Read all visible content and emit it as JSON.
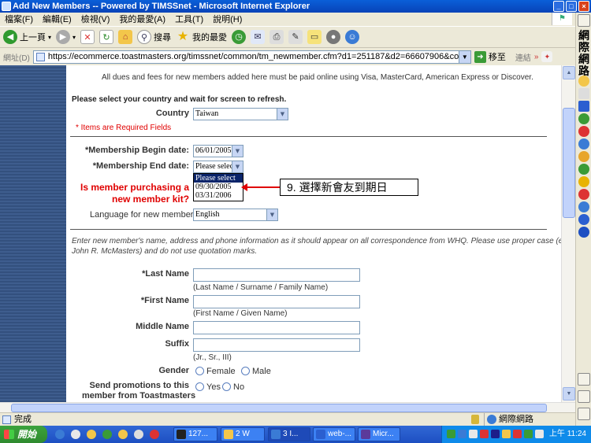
{
  "window": {
    "title": "Add New Members -- Powered by TIMSSnet - Microsoft Internet Explorer"
  },
  "menu": [
    "檔案(F)",
    "編輯(E)",
    "檢視(V)",
    "我的最愛(A)",
    "工具(T)",
    "說明(H)"
  ],
  "toolbar": {
    "back": "上一頁",
    "search": "搜尋",
    "favorites": "我的最愛"
  },
  "address": {
    "label": "網址(D)",
    "url": "https://ecommerce.toastmasters.org/timssnet/common/tm_newmember.cfm?d1=251187&d2=66607906&country=TW",
    "go": "移至",
    "links": "連結"
  },
  "sidebar": {
    "links_title": "網際網路"
  },
  "form": {
    "dues_notice": "All dues and fees for new members added here must be paid online using Visa, MasterCard, American Express or Discover.",
    "country_prompt": "Please select your country and wait for screen to refresh.",
    "country_label": "Country",
    "country_value": "Taiwan",
    "required_note": "* Items are Required Fields",
    "begin_label": "*Membership Begin date:",
    "begin_value": "06/01/2005",
    "end_label": "*Membership End date:",
    "end_value": "Please select",
    "end_options": [
      "Please select",
      "09/30/2005",
      "03/31/2006"
    ],
    "kit_question_line1": "Is member purchasing a",
    "kit_question_line2": "new member kit?",
    "language_label": "Language for new member kit:",
    "language_value": "English",
    "name_instructions_line1": "Enter new member's name, address and phone information as it should appear on all correspondence from WHQ. Please use proper case (ex:",
    "name_instructions_line2": "John R. McMasters) and do not use quotation marks.",
    "last_name_label": "*Last Name",
    "last_name_hint": "(Last Name / Surname / Family Name)",
    "first_name_label": "*First Name",
    "first_name_hint": "(First Name / Given Name)",
    "middle_name_label": "Middle Name",
    "suffix_label": "Suffix",
    "suffix_hint": "(Jr., Sr., III)",
    "gender_label": "Gender",
    "gender_female": "Female",
    "gender_male": "Male",
    "promo_line1": "Send promotions to this",
    "promo_line2": "member from Toastmasters",
    "promo_yes": "Yes",
    "promo_no": "No"
  },
  "callout": {
    "text": "9. 選擇新會友到期日"
  },
  "status": {
    "text": "完成",
    "zone": "網際網路"
  },
  "taskbar": {
    "start": "開始",
    "tasks": [
      "127...",
      "2 W",
      "3 I...",
      "web-...",
      "Micr..."
    ],
    "clock": "上午 11:24"
  },
  "colors": {
    "title_blue": "#0a5fd8",
    "required_red": "#e00000",
    "stripe": "#33507e"
  }
}
